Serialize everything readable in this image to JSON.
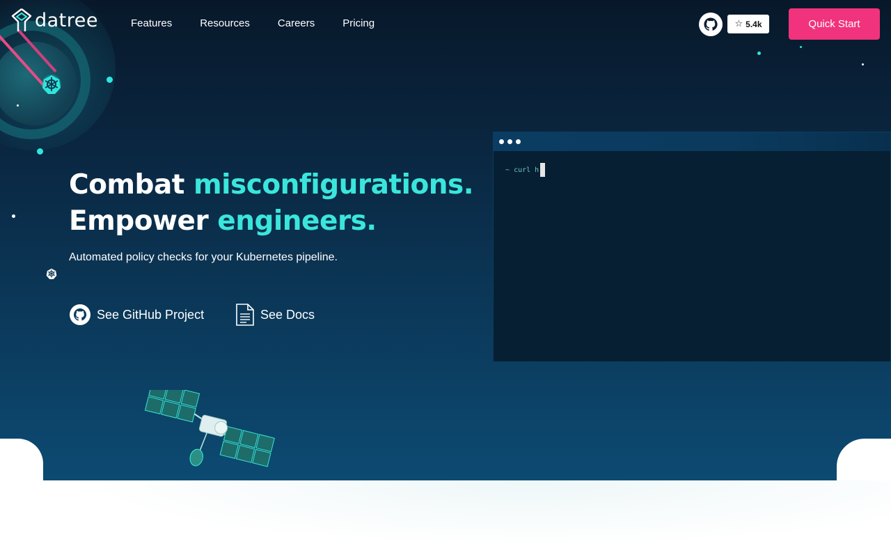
{
  "brand": {
    "name": "datree"
  },
  "nav": {
    "links": [
      "Features",
      "Resources",
      "Careers",
      "Pricing"
    ],
    "github_stars": "5.4k",
    "quick_start": "Quick Start"
  },
  "hero": {
    "headline_line1_a": "Combat",
    "headline_line1_b": "misconfigurations.",
    "headline_line2_a": "Empower",
    "headline_line2_b": "engineers.",
    "subtitle": "Automated policy checks for your Kubernetes pipeline.",
    "cta_github": "See GitHub Project",
    "cta_docs": "See Docs"
  },
  "terminal": {
    "prompt": "~",
    "command": "curl h"
  },
  "colors": {
    "accent": "#3ae6dc",
    "cta": "#f0337c",
    "hero_bg": "#0a2640"
  },
  "icons": {
    "github": "github-icon",
    "docs": "document-icon",
    "star": "star-icon",
    "kubernetes": "kubernetes-icon"
  }
}
